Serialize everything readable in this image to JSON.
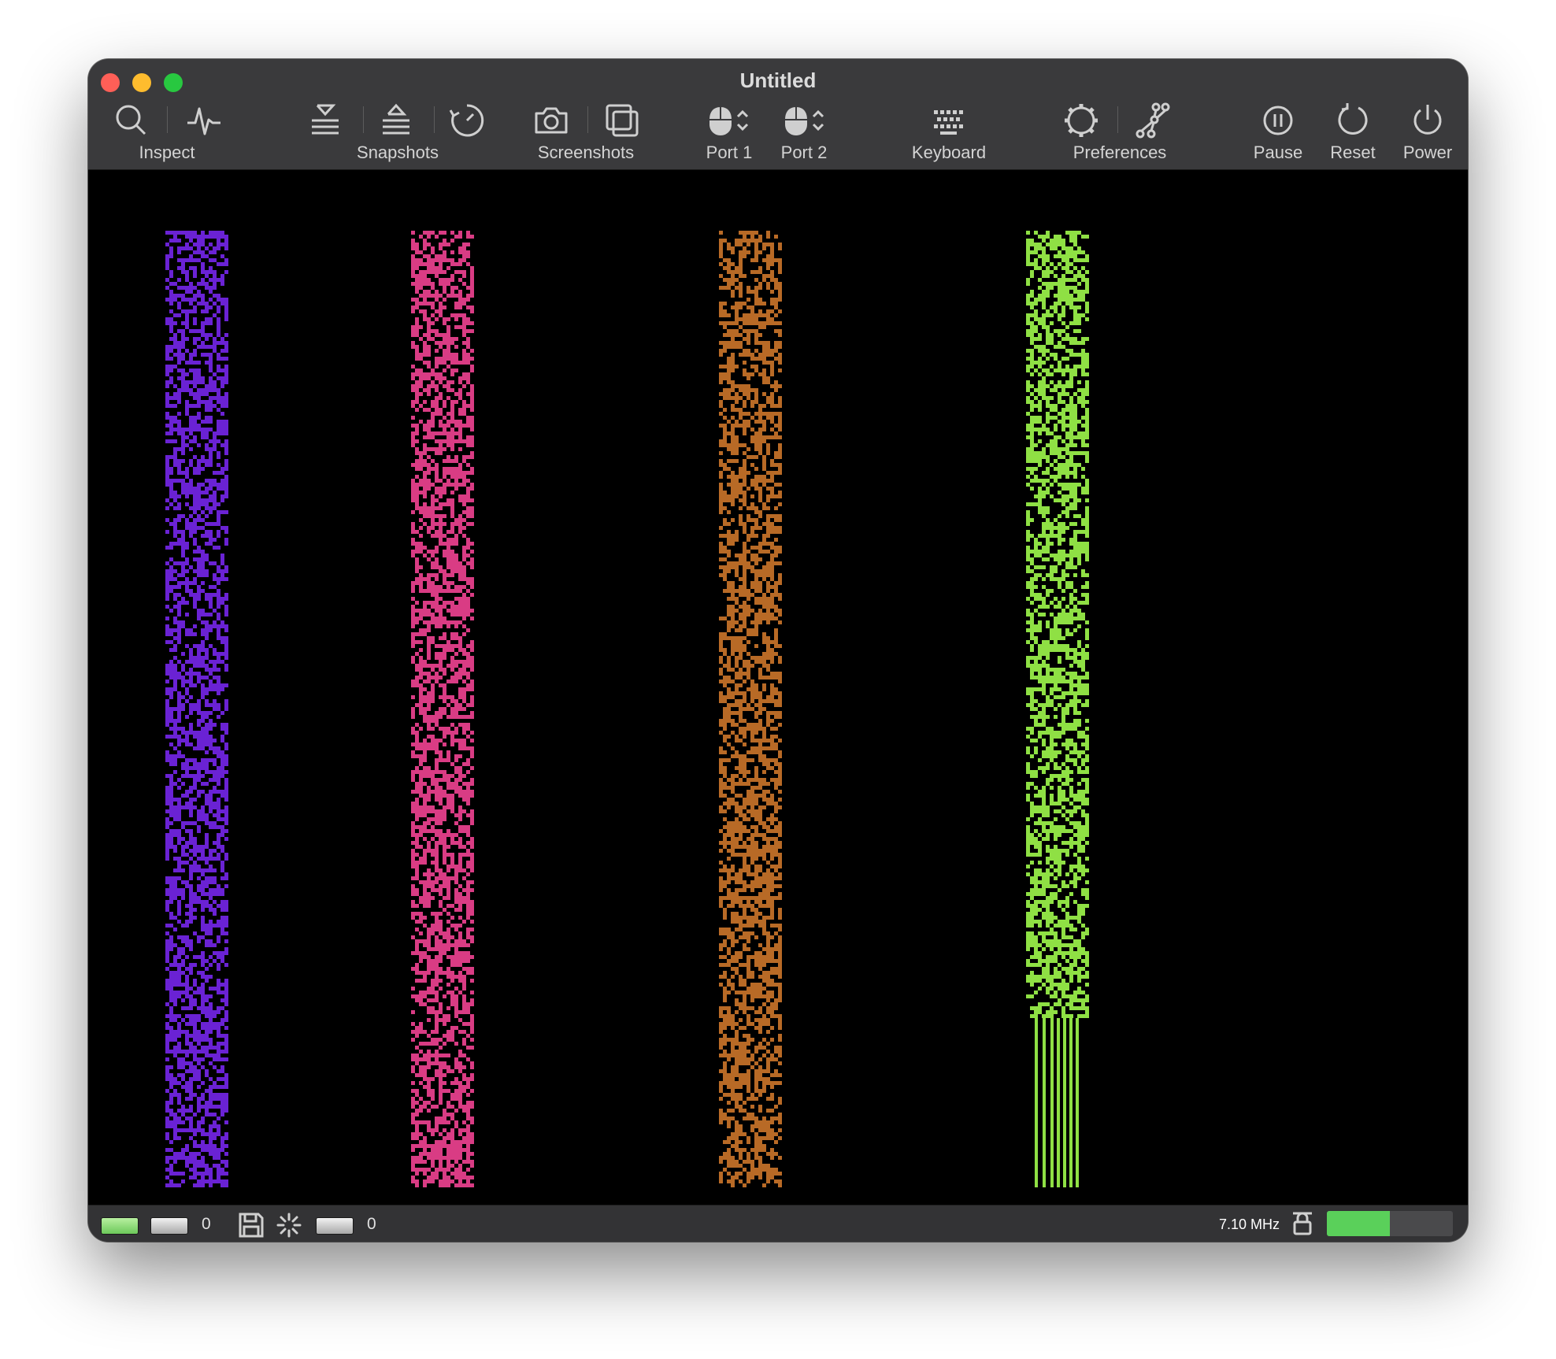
{
  "window": {
    "title": "Untitled"
  },
  "toolbar": {
    "inspect_label": "Inspect",
    "snapshots_label": "Snapshots",
    "screenshots_label": "Screenshots",
    "port1_label": "Port 1",
    "port2_label": "Port 2",
    "keyboard_label": "Keyboard",
    "preferences_label": "Preferences",
    "pause_label": "Pause",
    "reset_label": "Reset",
    "power_label": "Power"
  },
  "screen": {
    "background": "#000000",
    "stripes": [
      {
        "name": "purple-noise-stripe",
        "color": "#6a22d4"
      },
      {
        "name": "pink-noise-stripe",
        "color": "#d93c84"
      },
      {
        "name": "orange-noise-stripe",
        "color": "#b86a26"
      },
      {
        "name": "green-noise-stripe",
        "color": "#8fe044"
      }
    ]
  },
  "statusbar": {
    "drive1_count": "0",
    "drive2_count": "0",
    "speed": "7.10 MHz",
    "speed_meter_fraction": 0.5
  },
  "icons": [
    "search-icon",
    "activity-icon",
    "save-snapshot-icon",
    "restore-snapshot-icon",
    "clock-icon",
    "camera-icon",
    "gallery-icon",
    "mouse-icon",
    "chevron-updown-icon",
    "keyboard-icon",
    "gear-icon",
    "settings-nodes-icon",
    "pause-icon",
    "reset-icon",
    "power-icon",
    "floppy-icon",
    "spinner-icon",
    "lock-icon"
  ]
}
